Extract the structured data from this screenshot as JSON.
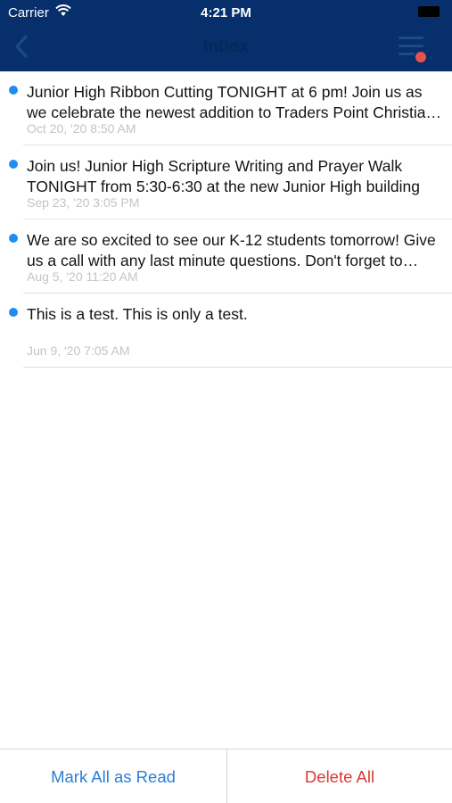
{
  "status_bar": {
    "carrier": "Carrier",
    "time": "4:21 PM",
    "wifi_icon": "wifi-icon",
    "battery_icon": "battery-icon"
  },
  "header": {
    "title": "Inbox",
    "background_color": "#062f6c",
    "back_icon": "chevron-left-icon",
    "menu_icon": "hamburger-menu-icon",
    "notification_dot_color": "#e8504d"
  },
  "messages": [
    {
      "text": "Junior High Ribbon Cutting TONIGHT at 6 pm! Join us as we celebrate the newest addition to Traders Point Christian Schools!",
      "date": "Oct 20, '20 8:50 AM",
      "unread": true
    },
    {
      "text": "Join us! Junior High Scripture Writing and Prayer Walk TONIGHT from 5:30-6:30 at the new Junior High building",
      "date": "Sep 23, '20 3:05 PM",
      "unread": true
    },
    {
      "text": "We are so excited to see our K-12 students tomorrow! Give us a call with any last minute questions. Don't forget to check in!",
      "date": "Aug 5, '20 11:20 AM",
      "unread": true
    },
    {
      "text": "This is a test. This is only a test.",
      "date": "Jun 9, '20 7:05 AM",
      "unread": true
    }
  ],
  "unread_dot_color": "#1d8ef0",
  "footer": {
    "mark_all_read": "Mark All as Read",
    "delete_all": "Delete All",
    "mark_color": "#2a7fd4",
    "delete_color": "#d93a33"
  }
}
